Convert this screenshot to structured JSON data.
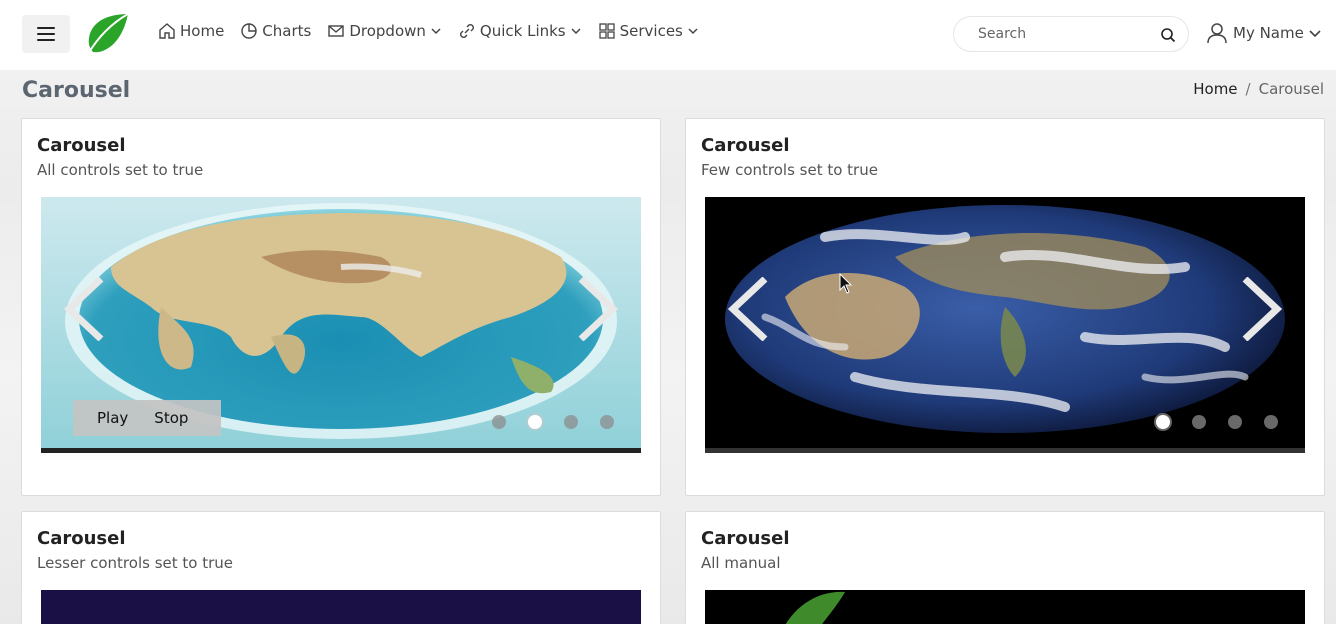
{
  "nav": {
    "items": [
      {
        "label": "Home",
        "icon": "home-icon"
      },
      {
        "label": "Charts",
        "icon": "chart-pie-icon"
      },
      {
        "label": "Dropdown",
        "icon": "mail-icon"
      },
      {
        "label": "Quick Links",
        "icon": "link-icon"
      },
      {
        "label": "Services",
        "icon": "grid-icon"
      }
    ],
    "search_placeholder": "Search",
    "user_name": "My Name"
  },
  "page": {
    "title": "Carousel",
    "breadcrumb": {
      "home": "Home",
      "separator": "/",
      "current": "Carousel"
    }
  },
  "cards": [
    {
      "title": "Carousel",
      "subtitle": "All controls set to true",
      "play_label": "Play",
      "stop_label": "Stop",
      "active_dot": 2,
      "dot_count": 4
    },
    {
      "title": "Carousel",
      "subtitle": "Few controls set to true",
      "active_dot": 1,
      "dot_count": 4
    },
    {
      "title": "Carousel",
      "subtitle": "Lesser controls set to true"
    },
    {
      "title": "Carousel",
      "subtitle": "All manual"
    }
  ],
  "colors": {
    "logo_green": "#2aa52a",
    "title_gray": "#5c6670"
  }
}
